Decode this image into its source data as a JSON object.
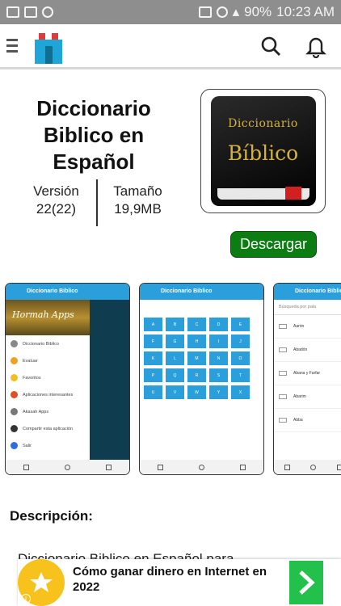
{
  "status_bar": {
    "battery": "90%",
    "time": "10:23 AM"
  },
  "app": {
    "title": "Diccionario Biblico en Español",
    "version_label": "Versión",
    "version_value": "22(22)",
    "size_label": "Tamaño",
    "size_value": "19,9MB",
    "download_label": "Descargar",
    "icon_text_line1": "Diccionario",
    "icon_text_line2": "Bíblico"
  },
  "screenshots": [
    {
      "bar_title": "Diccionario Biblico",
      "header_text": "Hormah Apps",
      "menu_items": [
        "Diccionario Biblico",
        "Evaluar",
        "Favoritos",
        "Aplicaciones interesantes",
        "Akasah Apps",
        "Compartir esta aplicación",
        "Salir"
      ]
    },
    {
      "bar_title": "Diccionario Biblico",
      "letters": [
        "A",
        "B",
        "C",
        "D",
        "E",
        "F",
        "G",
        "H",
        "I",
        "J",
        "K",
        "L",
        "M",
        "N",
        "O",
        "P",
        "Q",
        "R",
        "S",
        "T",
        "U",
        "V",
        "W",
        "Y",
        "X"
      ]
    },
    {
      "bar_title": "Diccionario Biblico",
      "search_placeholder": "Búsqueda por pala",
      "entries": [
        "Aarón",
        "Abadón",
        "Abana y Farfar",
        "Abarim",
        "Abba"
      ]
    }
  ],
  "description": {
    "heading": "Descripción:",
    "text": "Diccionario Biblico en Español para"
  },
  "ad": {
    "text": "Cómo ganar dinero en Internet en 2022",
    "info": "i",
    "accent": "#23c04b"
  },
  "colors": {
    "download": "#0c7d12",
    "screenshot_bar": "#2a9fdb",
    "ad_icon": "#f6c21b"
  }
}
